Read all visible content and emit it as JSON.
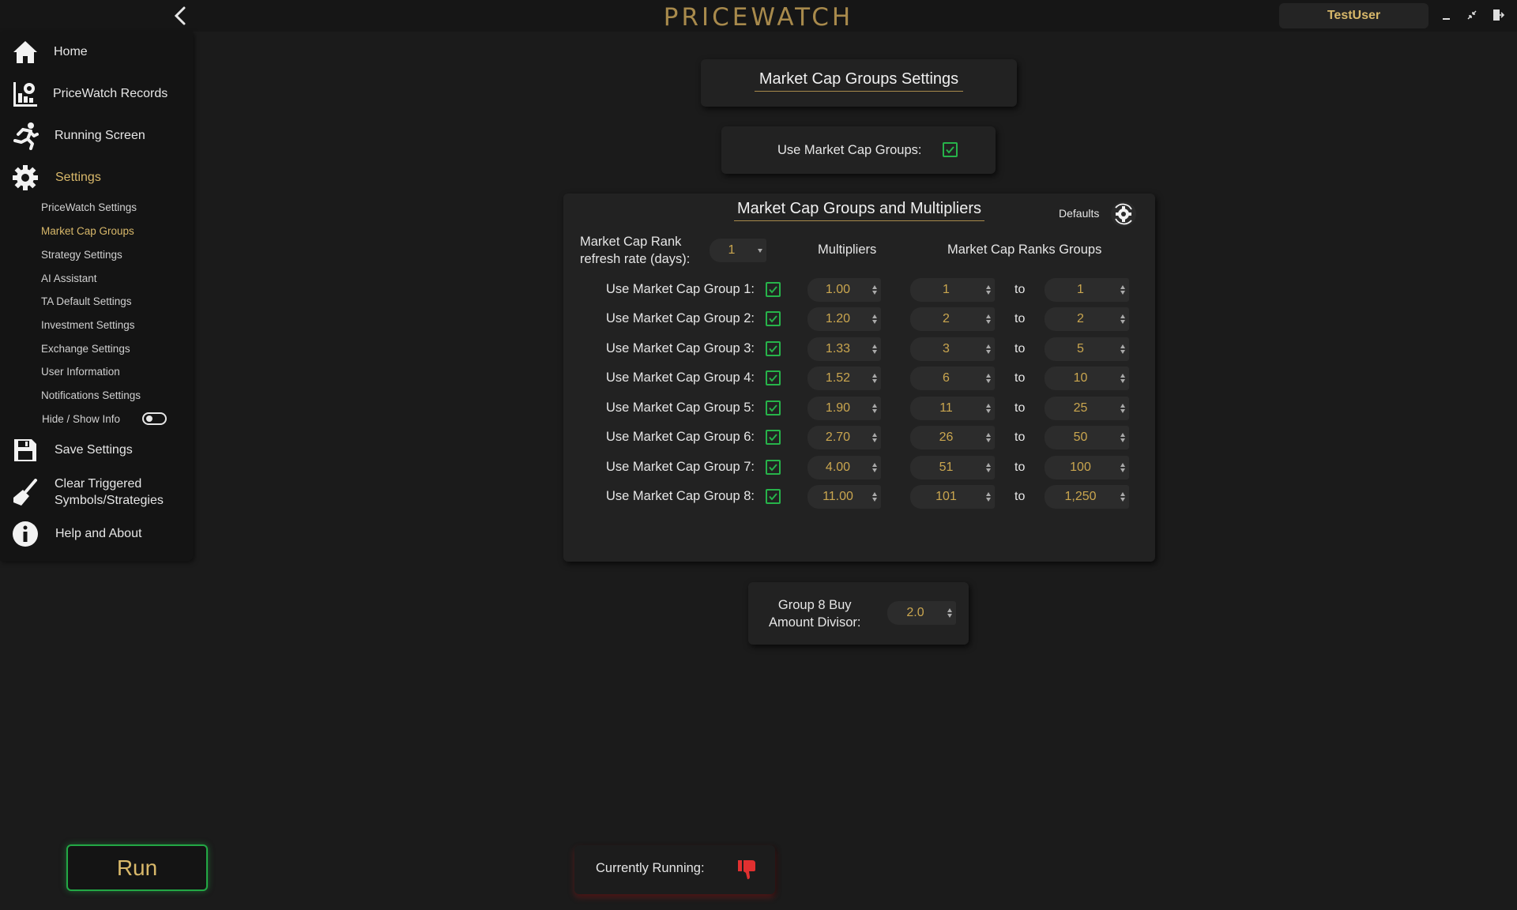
{
  "app": {
    "title": "PRICEWATCH",
    "user": "TestUser"
  },
  "sidebar": {
    "main_items": [
      {
        "label": "Home",
        "icon": "home-icon"
      },
      {
        "label": "PriceWatch Records",
        "icon": "records-chart-icon"
      },
      {
        "label": "Running Screen",
        "icon": "running-person-icon"
      },
      {
        "label": "Settings",
        "icon": "gear-icon",
        "active": true
      }
    ],
    "sub_items": [
      {
        "label": "PriceWatch Settings"
      },
      {
        "label": "Market Cap Groups",
        "active": true
      },
      {
        "label": "Strategy Settings"
      },
      {
        "label": "AI Assistant"
      },
      {
        "label": "TA Default Settings"
      },
      {
        "label": "Investment Settings"
      },
      {
        "label": "Exchange Settings"
      },
      {
        "label": "User Information"
      },
      {
        "label": "Notifications Settings"
      }
    ],
    "toggle_label": "Hide / Show Info",
    "toggle_on": false,
    "bottom_items": [
      {
        "label": "Save Settings",
        "icon": "floppy-disk-icon"
      },
      {
        "label": "Clear Triggered",
        "label2": "Symbols/Strategies",
        "icon": "broom-icon"
      },
      {
        "label": "Help and About",
        "icon": "info-icon"
      }
    ]
  },
  "page": {
    "title": "Market Cap Groups Settings",
    "use_groups_label": "Use Market Cap Groups:",
    "use_groups_checked": true
  },
  "groups_panel": {
    "title": "Market Cap Groups and Multipliers",
    "defaults_label": "Defaults",
    "refresh_label_line1": "Market Cap Rank",
    "refresh_label_line2": "refresh rate (days):",
    "refresh_value": "1",
    "col_multipliers": "Multipliers",
    "col_ranks": "Market Cap Ranks Groups",
    "to_label": "to",
    "rows": [
      {
        "label": "Use Market Cap Group 1:",
        "checked": true,
        "multiplier": "1.00",
        "from": "1",
        "to": "1"
      },
      {
        "label": "Use Market Cap Group 2:",
        "checked": true,
        "multiplier": "1.20",
        "from": "2",
        "to": "2"
      },
      {
        "label": "Use Market Cap Group 3:",
        "checked": true,
        "multiplier": "1.33",
        "from": "3",
        "to": "5"
      },
      {
        "label": "Use Market Cap Group 4:",
        "checked": true,
        "multiplier": "1.52",
        "from": "6",
        "to": "10"
      },
      {
        "label": "Use Market Cap Group 5:",
        "checked": true,
        "multiplier": "1.90",
        "from": "11",
        "to": "25"
      },
      {
        "label": "Use Market Cap Group 6:",
        "checked": true,
        "multiplier": "2.70",
        "from": "26",
        "to": "50"
      },
      {
        "label": "Use Market Cap Group 7:",
        "checked": true,
        "multiplier": "4.00",
        "from": "51",
        "to": "100"
      },
      {
        "label": "Use Market Cap Group 8:",
        "checked": true,
        "multiplier": "11.00",
        "from": "101",
        "to": "1,250"
      }
    ]
  },
  "divisor": {
    "label_line1": "Group 8 Buy",
    "label_line2": "Amount Divisor:",
    "value": "2.0"
  },
  "footer": {
    "run_label": "Run",
    "status_label": "Currently Running:",
    "status_icon": "thumbs-down-icon",
    "status_color": "#e03030"
  },
  "colors": {
    "accent_gold": "#d8b86a",
    "check_green": "#27b34a",
    "run_green": "#23a845"
  }
}
